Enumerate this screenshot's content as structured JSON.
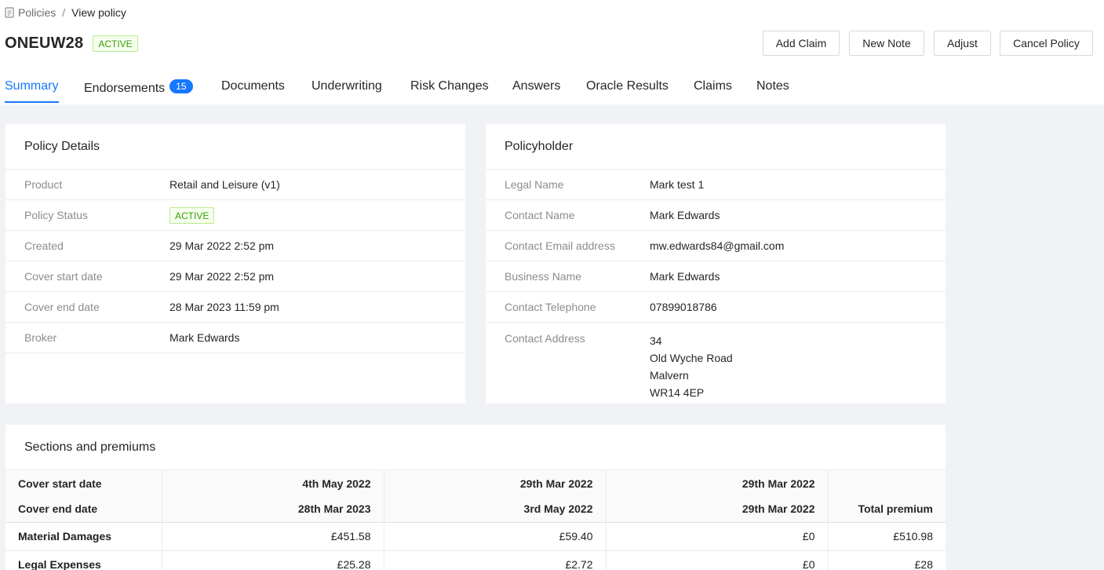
{
  "breadcrumb": {
    "parent": "Policies",
    "separator": "/",
    "current": "View policy"
  },
  "policy": {
    "reference": "ONEUW28",
    "status": "ACTIVE"
  },
  "actions": {
    "add_claim": "Add Claim",
    "new_note": "New Note",
    "adjust": "Adjust",
    "cancel_policy": "Cancel Policy"
  },
  "tabs": [
    {
      "label": "Summary"
    },
    {
      "label": "Endorsements",
      "badge": "15"
    },
    {
      "label": "Documents"
    },
    {
      "label": "Underwriting"
    },
    {
      "label": "Risk Changes"
    },
    {
      "label": "Answers"
    },
    {
      "label": "Oracle Results"
    },
    {
      "label": "Claims"
    },
    {
      "label": "Notes"
    }
  ],
  "policy_details": {
    "title": "Policy Details",
    "rows": [
      {
        "label": "Product",
        "value": "Retail and Leisure (v1)"
      },
      {
        "label": "Policy Status",
        "value": "ACTIVE"
      },
      {
        "label": "Created",
        "value": "29 Mar 2022 2:52 pm"
      },
      {
        "label": "Cover start date",
        "value": "29 Mar 2022 2:52 pm"
      },
      {
        "label": "Cover end date",
        "value": "28 Mar 2023 11:59 pm"
      },
      {
        "label": "Broker",
        "value": "Mark Edwards"
      }
    ]
  },
  "policyholder": {
    "title": "Policyholder",
    "rows": [
      {
        "label": "Legal Name",
        "value": "Mark test 1"
      },
      {
        "label": "Contact Name",
        "value": "Mark Edwards"
      },
      {
        "label": "Contact Email address",
        "value": "mw.edwards84@gmail.com"
      },
      {
        "label": "Business Name",
        "value": "Mark Edwards"
      },
      {
        "label": "Contact Telephone",
        "value": "07899018786"
      }
    ],
    "address_label": "Contact Address",
    "address_lines": [
      "34",
      "Old Wyche Road",
      "Malvern",
      "WR14 4EP"
    ]
  },
  "sections": {
    "title": "Sections and premiums",
    "start_label": "Cover start date",
    "end_label": "Cover end date",
    "total_label": "Total premium",
    "periods": [
      {
        "start": "4th May 2022",
        "end": "28th Mar 2023"
      },
      {
        "start": "29th Mar 2022",
        "end": "3rd May 2022"
      },
      {
        "start": "29th Mar 2022",
        "end": "29th Mar 2022"
      }
    ],
    "rows": [
      {
        "name": "Material Damages",
        "values": [
          "£451.58",
          "£59.40",
          "£0"
        ],
        "total": "£510.98"
      },
      {
        "name": "Legal Expenses",
        "values": [
          "£25.28",
          "£2.72",
          "£0"
        ],
        "total": "£28"
      }
    ]
  }
}
